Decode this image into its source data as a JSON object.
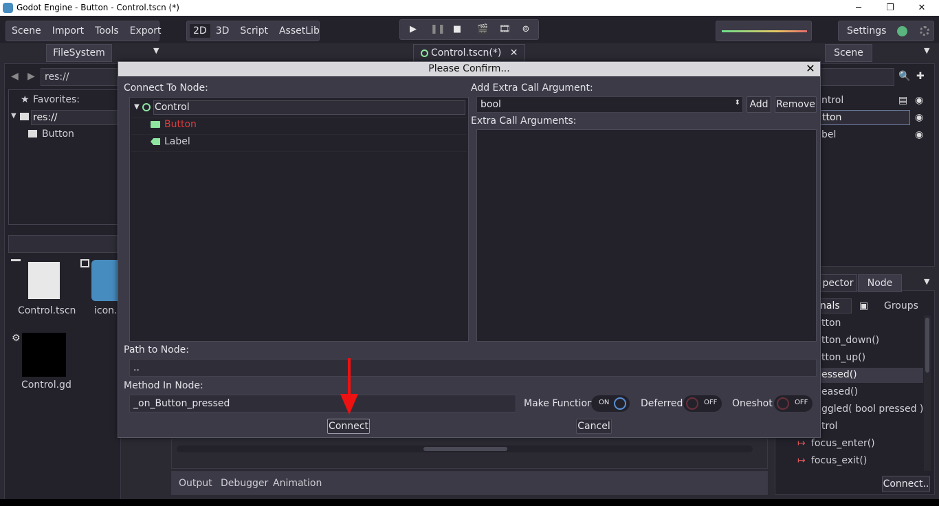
{
  "window": {
    "title": "Godot Engine - Button - Control.tscn (*)",
    "controls": [
      "─",
      "❐",
      "✕"
    ]
  },
  "menu": [
    "Scene",
    "Import",
    "Tools",
    "Export"
  ],
  "modes": [
    "2D",
    "3D",
    "Script",
    "AssetLib"
  ],
  "settings_label": "Settings",
  "filesystem": {
    "tab": "FileSystem",
    "path": "res://",
    "favorites": "Favorites:",
    "tree": [
      "res://",
      "Button"
    ],
    "files": [
      {
        "name": "Control.tscn"
      },
      {
        "name": "icon.p"
      },
      {
        "name": "Control.gd"
      }
    ]
  },
  "scene_tab": "Control.tscn(*)",
  "scene_dock": {
    "tab": "Scene",
    "nodes": [
      "ntrol",
      "tton",
      "bel"
    ]
  },
  "node_dock": {
    "tabs": [
      "pector",
      "Node"
    ],
    "subtabs": [
      "nals",
      "Groups"
    ],
    "signals": [
      "tton",
      "tton_down()",
      "tton_up()",
      "essed()",
      "eased()",
      "ggled( bool pressed )",
      "trol",
      "focus_enter()",
      "focus_exit()"
    ],
    "connect_button": "Connect.."
  },
  "bottom_tabs": [
    "Output",
    "Debugger",
    "Animation"
  ],
  "dialog": {
    "title": "Please Confirm...",
    "connect_to_node_label": "Connect To Node:",
    "nodes": [
      {
        "name": "Control",
        "color": "#e4e4ea"
      },
      {
        "name": "Button",
        "color": "#e03c3c"
      },
      {
        "name": "Label",
        "color": "#cfcfd6"
      }
    ],
    "extra_arg_label": "Add Extra Call Argument:",
    "arg_type": "bool",
    "add_button": "Add",
    "remove_button": "Remove",
    "extra_args_label": "Extra Call Arguments:",
    "path_label": "Path to Node:",
    "path_value": "..",
    "method_label": "Method In Node:",
    "method_value": "_on_Button_pressed",
    "make_function_label": "Make Function",
    "make_function_state": "ON",
    "deferred_label": "Deferred",
    "deferred_state": "OFF",
    "oneshot_label": "Oneshot",
    "oneshot_state": "OFF",
    "connect_button": "Connect",
    "cancel_button": "Cancel"
  },
  "colors": {
    "accent_red": "#e03c3c",
    "signal_icon": "#e05a5a",
    "node_icon_green": "#8ee6a0"
  }
}
